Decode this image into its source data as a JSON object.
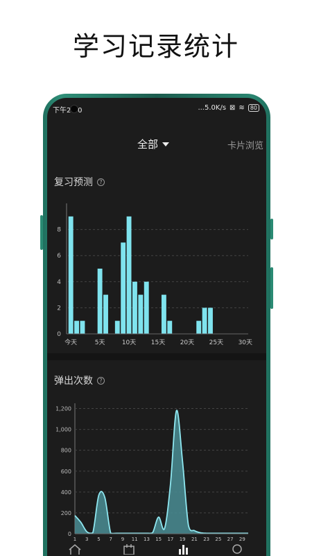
{
  "headline": "学习记录统计",
  "status": {
    "time": "下午2:50",
    "speed": "...5.0K/s",
    "battery": "80"
  },
  "nav": {
    "filter_label": "全部",
    "card_browse_label": "卡片浏览"
  },
  "section1": {
    "title": "复习预测"
  },
  "section2": {
    "title": "弹出次数"
  },
  "colors": {
    "bar": "#7fe3ee",
    "area_fill": "#4a8d94",
    "area_line": "#8fe7f0",
    "background": "#1c1c1c"
  },
  "chart_data": [
    {
      "type": "bar",
      "title": "复习预测",
      "x": [
        0,
        1,
        2,
        3,
        4,
        5,
        6,
        7,
        8,
        9,
        10,
        11,
        12,
        13,
        14,
        15,
        16,
        17,
        18,
        19,
        20,
        21,
        22,
        23,
        24,
        25,
        26,
        27,
        28,
        29,
        30
      ],
      "values": [
        9,
        1,
        1,
        0,
        0,
        5,
        3,
        0,
        1,
        7,
        9,
        4,
        3,
        4,
        0,
        0,
        3,
        1,
        0,
        0,
        0,
        0,
        1,
        2,
        2,
        0,
        0,
        0,
        0,
        0,
        0
      ],
      "x_tick_labels": [
        "今天",
        "5天",
        "10天",
        "15天",
        "20天",
        "25天",
        "30天"
      ],
      "x_tick_positions": [
        0,
        5,
        10,
        15,
        20,
        25,
        30
      ],
      "y_ticks": [
        0,
        2,
        4,
        6,
        8
      ],
      "y_tick_labels": [
        "0",
        "2",
        "4",
        "6",
        "8"
      ],
      "ylim": [
        0,
        10
      ],
      "grid": true
    },
    {
      "type": "area",
      "title": "弹出次数",
      "x": [
        1,
        2,
        3,
        4,
        5,
        6,
        7,
        8,
        9,
        10,
        11,
        12,
        13,
        14,
        15,
        16,
        17,
        18,
        19,
        20,
        21,
        22,
        23,
        24,
        25,
        26,
        27,
        28,
        29,
        30
      ],
      "values": [
        175,
        110,
        20,
        10,
        370,
        350,
        5,
        5,
        5,
        5,
        5,
        5,
        5,
        10,
        160,
        50,
        480,
        1180,
        700,
        80,
        30,
        10,
        5,
        5,
        5,
        5,
        5,
        5,
        5,
        5
      ],
      "x_tick_labels": [
        "1",
        "3",
        "5",
        "7",
        "9",
        "11",
        "13",
        "15",
        "17",
        "19",
        "21",
        "23",
        "25",
        "27",
        "29"
      ],
      "y_ticks": [
        0,
        200,
        400,
        600,
        800,
        1000,
        1200
      ],
      "y_tick_labels": [
        "0",
        "200",
        "400",
        "600",
        "800",
        "1,000",
        "1,200"
      ],
      "ylim": [
        0,
        1250
      ],
      "grid": true
    }
  ]
}
